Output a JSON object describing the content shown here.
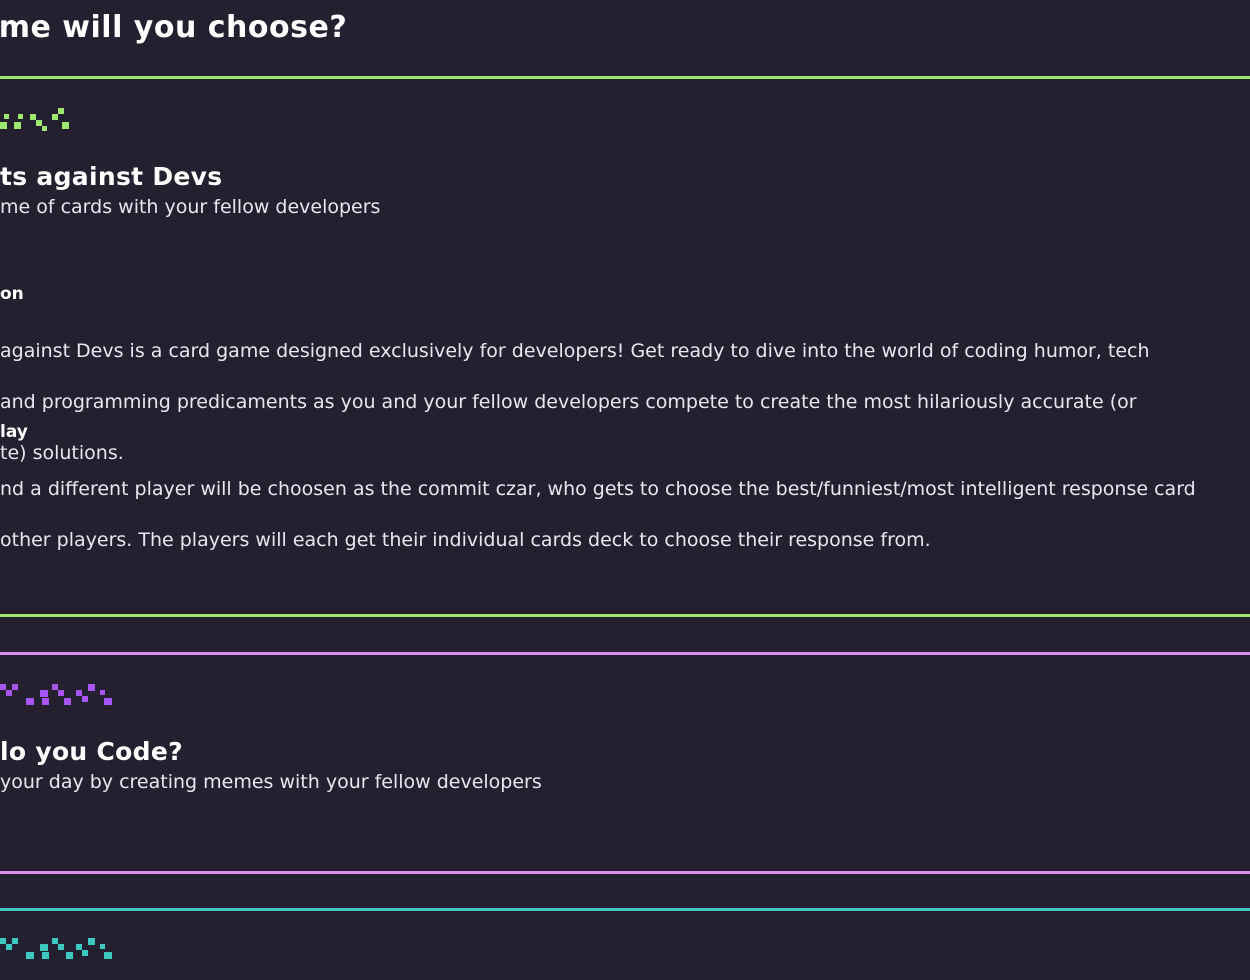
{
  "page": {
    "title": "ame will you choose?"
  },
  "games": [
    {
      "accent": "#9fe870",
      "title": "ts against Devs",
      "tagline": "me of cards with your fellow developers",
      "sections": [
        {
          "heading": "on",
          "lines": [
            "against Devs is a card game designed exclusively for developers! Get ready to dive into the world of coding humor, tech",
            "and programming predicaments as you and your fellow developers compete to create the most hilariously accurate (or",
            "te) solutions."
          ]
        },
        {
          "heading": "lay",
          "lines": [
            "nd a different player will be choosen as the commit czar, who gets to choose the best/funniest/most intelligent response card",
            "other players. The players will each get their individual cards deck to choose their response from."
          ]
        }
      ]
    },
    {
      "accent": "#d98ef0",
      "pixel_color": "#a855f7",
      "title": "lo you Code?",
      "tagline": "your day by creating memes with your fellow developers"
    },
    {
      "accent": "#3ec9c0",
      "pixel_color": "#3ec9c0"
    }
  ]
}
